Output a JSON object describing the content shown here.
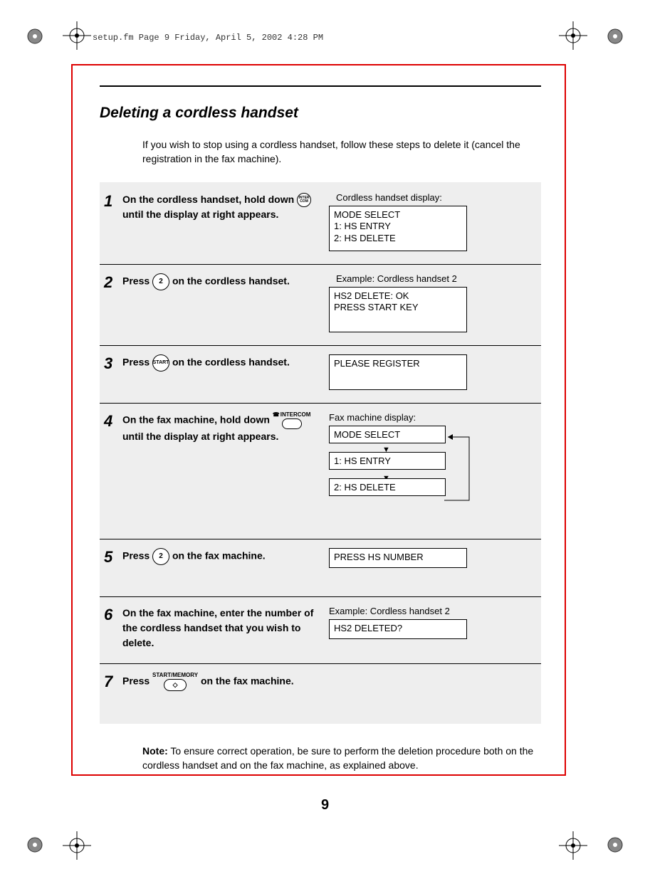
{
  "header": "setup.fm  Page 9  Friday, April 5, 2002  4:28 PM",
  "title": "Deleting a cordless handset",
  "intro": "If you wish to stop using a cordless handset, follow these steps to delete it (cancel the registration in the fax machine).",
  "steps": [
    {
      "num": "1",
      "text_a": "On the cordless handset, hold down ",
      "btn": "INTER\nCOM",
      "text_b": " until the display at right appears.",
      "caption": "Cordless handset display:",
      "display": "MODE SELECT\n1: HS ENTRY\n2: HS DELETE"
    },
    {
      "num": "2",
      "text_a": "Press ",
      "btn": "2",
      "text_b": " on the cordless handset.",
      "caption": "Example: Cordless handset 2",
      "display": "HS2 DELETE: OK\nPRESS START KEY"
    },
    {
      "num": "3",
      "text_a": "Press ",
      "btn": "START",
      "text_b": " on the cordless handset.",
      "caption": "",
      "display": "PLEASE REGISTER"
    },
    {
      "num": "4",
      "text_a": "On the fax machine, hold down ",
      "btn_label": "INTERCOM",
      "text_b": "until the display at right appears.",
      "caption": "Fax machine display:",
      "fax_displays": [
        "MODE SELECT",
        "1: HS ENTRY",
        "2: HS DELETE"
      ]
    },
    {
      "num": "5",
      "text_a": "Press ",
      "btn": "2",
      "text_b": " on the fax machine.",
      "caption": "",
      "display": "PRESS HS NUMBER"
    },
    {
      "num": "6",
      "text_a": "On the fax machine, enter the number of the cordless handset that you wish to delete.",
      "caption": "Example: Cordless handset 2",
      "display": "HS2 DELETED?"
    },
    {
      "num": "7",
      "text_a": "Press ",
      "btn_label": "START/MEMORY",
      "text_b": " on the fax machine."
    }
  ],
  "note_label": "Note:",
  "note_text": " To ensure correct operation, be sure to perform the deletion procedure both on the cordless handset and on the fax machine, as explained above.",
  "page_number": "9"
}
